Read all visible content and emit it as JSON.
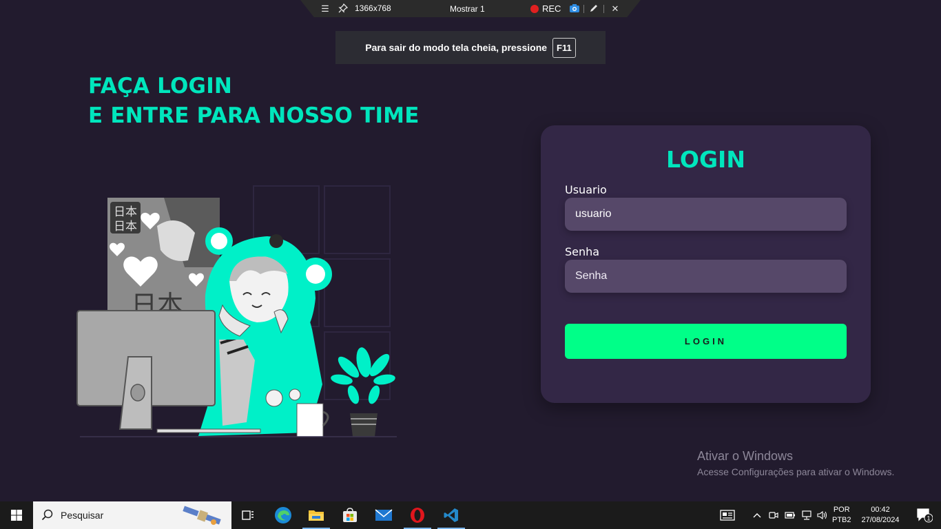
{
  "recorder_bar": {
    "resolution": "1366x768",
    "display": "Mostrar 1",
    "rec_label": "REC"
  },
  "fullscreen_notice": {
    "text": "Para sair do modo tela cheia, pressione",
    "key": "F11"
  },
  "headline": {
    "line1": "FAÇA LOGIN",
    "line2": "E ENTRE PARA NOSSO TIME"
  },
  "illustration": {
    "kanji_top": "日本",
    "kanji_bottom": "日本",
    "kanji_large": "日本"
  },
  "login": {
    "title": "LOGIN",
    "username_label": "Usuario",
    "username_value": "usuario",
    "password_label": "Senha",
    "password_placeholder": "Senha",
    "button_label": "LOGIN"
  },
  "watermark": {
    "title": "Ativar o Windows",
    "subtitle": "Acesse Configurações para ativar o Windows."
  },
  "taskbar": {
    "search_placeholder": "Pesquisar",
    "language_line1": "POR",
    "language_line2": "PTB2",
    "time": "00:42",
    "date": "27/08/2024",
    "notification_count": "1"
  },
  "colors": {
    "background": "#221b2e",
    "accent": "#00e6bd",
    "card": "#332746",
    "input": "#564869",
    "button": "#00ff88"
  }
}
